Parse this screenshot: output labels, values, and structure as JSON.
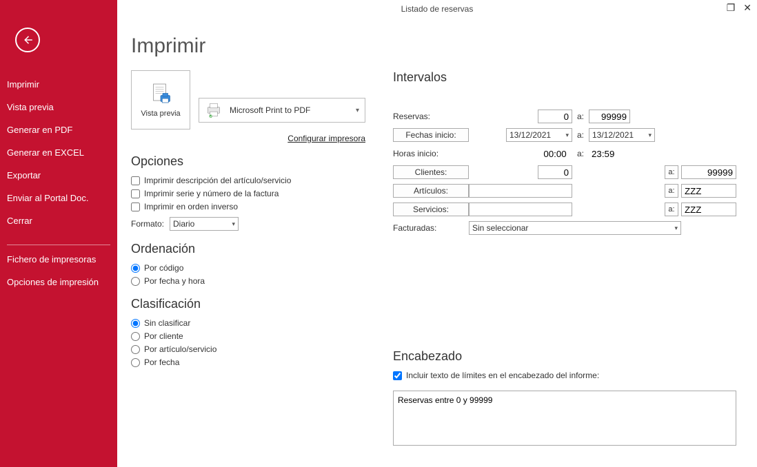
{
  "window": {
    "title": "Listado de reservas"
  },
  "sidebar": {
    "items": [
      "Imprimir",
      "Vista previa",
      "Generar en PDF",
      "Generar en EXCEL",
      "Exportar",
      "Enviar al Portal Doc.",
      "Cerrar"
    ],
    "extra": [
      "Fichero de impresoras",
      "Opciones de impresión"
    ]
  },
  "page": {
    "title": "Imprimir",
    "preview_label": "Vista previa",
    "printer_name": "Microsoft Print to PDF",
    "configure_label": "Configurar impresora"
  },
  "opciones": {
    "heading": "Opciones",
    "chk1": "Imprimir descripción del artículo/servicio",
    "chk2": "Imprimir serie y número de la factura",
    "chk3": "Imprimir en orden inverso",
    "formato_label": "Formato:",
    "formato_value": "Diario"
  },
  "ordenacion": {
    "heading": "Ordenación",
    "r1": "Por código",
    "r2": "Por fecha y hora"
  },
  "clasificacion": {
    "heading": "Clasificación",
    "r1": "Sin clasificar",
    "r2": "Por cliente",
    "r3": "Por artículo/servicio",
    "r4": "Por fecha"
  },
  "intervalos": {
    "heading": "Intervalos",
    "reservas_label": "Reservas:",
    "reservas_from": "0",
    "reservas_to": "99999",
    "fechas_btn": "Fechas inicio:",
    "fecha_from": "13/12/2021",
    "fecha_to": "13/12/2021",
    "horas_label": "Horas inicio:",
    "hora_from": "00:00",
    "hora_to": "23:59",
    "clientes_btn": "Clientes:",
    "clientes_from": "0",
    "clientes_to": "99999",
    "articulos_btn": "Artículos:",
    "articulos_from": "",
    "articulos_to": "ZZZ",
    "servicios_btn": "Servicios:",
    "servicios_from": "",
    "servicios_to": "ZZZ",
    "facturadas_label": "Facturadas:",
    "facturadas_value": "Sin seleccionar",
    "a_label": "a:"
  },
  "encabezado": {
    "heading": "Encabezado",
    "chk_label": "Incluir texto de límites en el encabezado del informe:",
    "text_value": "Reservas entre 0 y 99999"
  }
}
